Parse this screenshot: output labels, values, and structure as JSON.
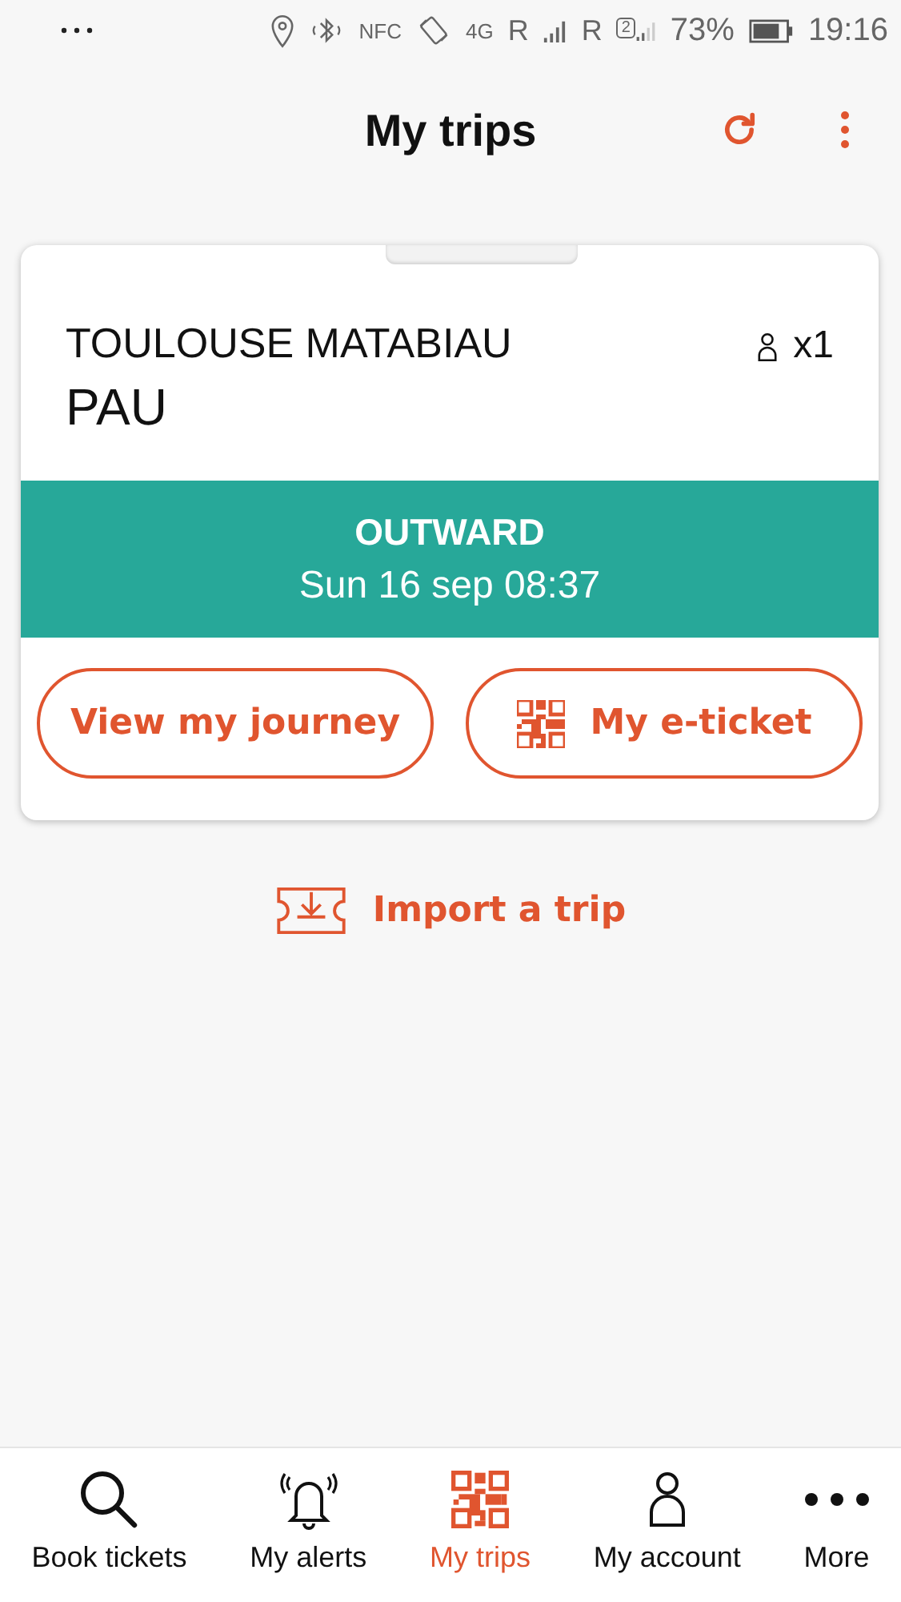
{
  "status_bar": {
    "nfc": "NFC",
    "network": "4G",
    "roaming_1": "R",
    "roaming_2": "R",
    "sim_2": "2",
    "battery": "73%",
    "time": "19:16"
  },
  "header": {
    "title": "My trips"
  },
  "trips": [
    {
      "origin": "TOULOUSE MATABIAU",
      "destination": "PAU",
      "passengers": "x1",
      "direction": "OUTWARD",
      "departure": "Sun 16 sep 08:37",
      "journey_button": "View my journey",
      "ticket_button": "My e-ticket"
    }
  ],
  "import_button": "Import a trip",
  "nav": [
    {
      "kind": "search",
      "label": "Book tickets",
      "selected": false
    },
    {
      "kind": "alerts",
      "label": "My alerts",
      "selected": false
    },
    {
      "kind": "trips",
      "label": "My trips",
      "selected": true
    },
    {
      "kind": "account",
      "label": "My account",
      "selected": false
    },
    {
      "kind": "more",
      "label": "More",
      "selected": false
    }
  ]
}
